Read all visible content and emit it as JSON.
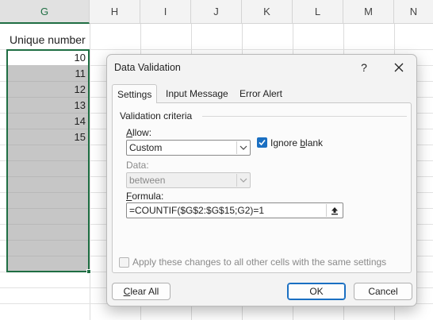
{
  "sheet": {
    "columns": [
      "G",
      "H",
      "I",
      "J",
      "K",
      "L",
      "M",
      "N"
    ],
    "selected_column": "G",
    "header_cell": "Unique number",
    "values": [
      "10",
      "11",
      "12",
      "13",
      "14",
      "15"
    ]
  },
  "dialog": {
    "title": "Data Validation",
    "help": "?",
    "close": "✕",
    "tabs": [
      "Settings",
      "Input Message",
      "Error Alert"
    ],
    "active_tab": "Settings",
    "section": "Validation criteria",
    "allow_label": "Allow:",
    "allow_value": "Custom",
    "ignore_blank_label": "Ignore blank",
    "ignore_blank_checked": true,
    "data_label": "Data:",
    "data_value": "between",
    "formula_label": "Formula:",
    "formula_value": "=COUNTIF($G$2:$G$15;G2)=1",
    "apply_label": "Apply these changes to all other cells with the same settings",
    "buttons": {
      "clear_all": "Clear All",
      "ok": "OK",
      "cancel": "Cancel"
    }
  },
  "colors": {
    "accent": "#1a6fc2",
    "selection": "#1f6e43",
    "fill": "#c6c6c6"
  },
  "icons": [
    "chevron-down-icon",
    "collapse-dialog-icon",
    "close-icon",
    "help-icon",
    "checkmark-icon"
  ]
}
